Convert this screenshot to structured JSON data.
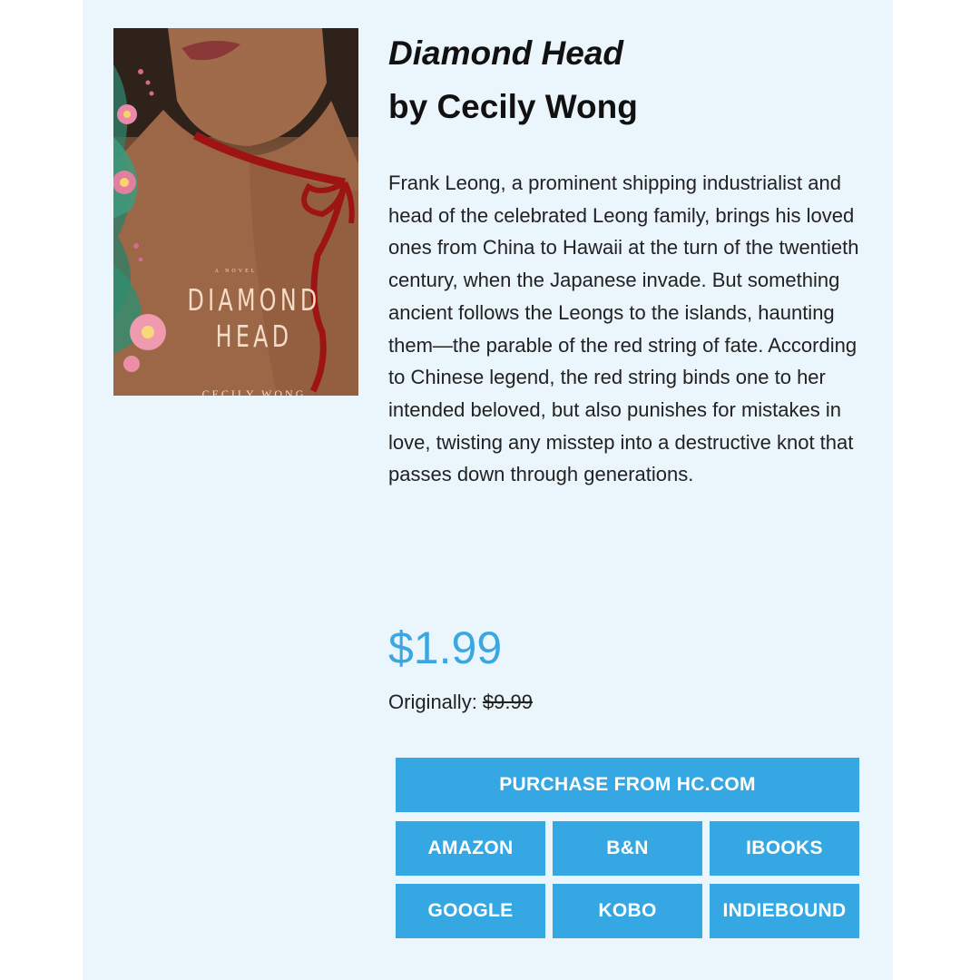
{
  "book": {
    "title": "Diamond Head",
    "author_line": "by Cecily Wong",
    "description": "Frank Leong, a prominent shipping industrialist and head of the celebrated Leong family, brings his loved ones from China to Hawaii at the turn of the twentieth century, when the Japanese invade. But something ancient follows the Leongs to the islands, haunting them—the parable of the red string of fate. According to Chinese legend, the red string binds one to her intended beloved, but also punishes for mistakes in love, twisting any misstep into a destructive knot that passes down through generations."
  },
  "cover": {
    "novel_label": "A NOVEL",
    "title_line1": "DIAMOND",
    "title_line2": "HEAD",
    "author": "CECILY WONG"
  },
  "pricing": {
    "sale_price": "$1.99",
    "original_label": "Originally:",
    "original_price": "$9.99"
  },
  "buttons": {
    "primary": "PURCHASE FROM HC.COM",
    "amazon": "AMAZON",
    "bn": "B&N",
    "ibooks": "IBOOKS",
    "google": "GOOGLE",
    "kobo": "KOBO",
    "indiebound": "INDIEBOUND"
  },
  "colors": {
    "panel_background": "#eaf5fc",
    "accent": "#35a8e3",
    "price": "#3aa7e0"
  }
}
